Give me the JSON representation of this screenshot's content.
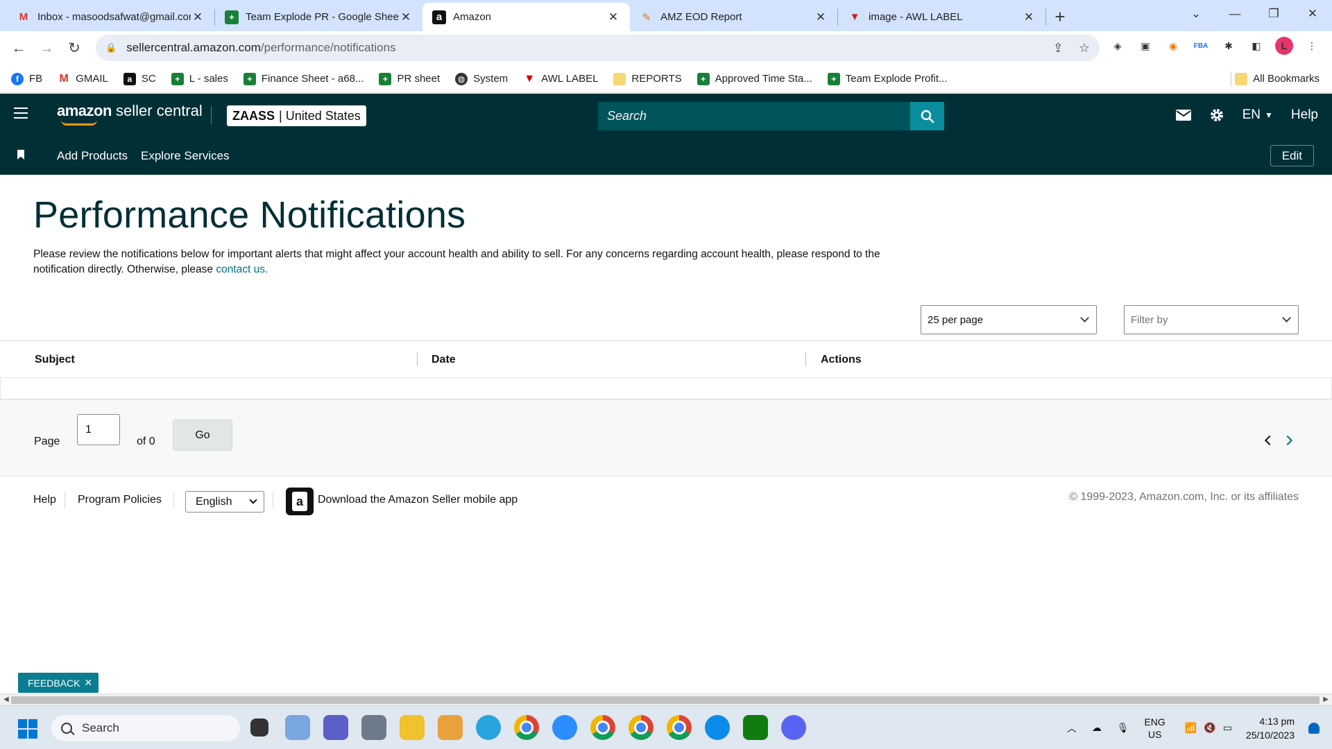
{
  "browser": {
    "tabs": [
      {
        "title": "Inbox - masoodsafwat@gmail.com",
        "icon": "gmail-icon",
        "active": false
      },
      {
        "title": "Team Explode PR - Google Sheets",
        "icon": "sheets-icon",
        "active": false
      },
      {
        "title": "Amazon",
        "icon": "amazon-icon",
        "active": true
      },
      {
        "title": "AMZ EOD Report",
        "icon": "report-icon",
        "active": false
      },
      {
        "title": "image - AWL LABEL",
        "icon": "awl-icon",
        "active": false
      }
    ],
    "url_host": "sellercentral.amazon.com",
    "url_path": "/performance/notifications",
    "profile_initial": "L",
    "bookmarks": [
      {
        "label": "FB",
        "icon": "facebook-icon"
      },
      {
        "label": "GMAIL",
        "icon": "gmail-icon"
      },
      {
        "label": "SC",
        "icon": "amazon-icon"
      },
      {
        "label": "L - sales",
        "icon": "sheets-icon"
      },
      {
        "label": "Finance Sheet - a68...",
        "icon": "sheets-icon"
      },
      {
        "label": "PR sheet",
        "icon": "sheets-icon"
      },
      {
        "label": "System",
        "icon": "globe-icon"
      },
      {
        "label": "AWL LABEL",
        "icon": "awl-icon"
      },
      {
        "label": "REPORTS",
        "icon": "folder-icon"
      },
      {
        "label": "Approved Time Sta...",
        "icon": "sheets-icon"
      },
      {
        "label": "Team Explode Profit...",
        "icon": "sheets-icon"
      }
    ],
    "all_bookmarks": "All Bookmarks"
  },
  "header": {
    "logo_bold": "amazon",
    "logo_rest": " seller central",
    "store_name": "ZAASS",
    "store_region": "| United States",
    "search_placeholder": "Search",
    "language": "EN",
    "help": "Help",
    "nav": [
      "Add Products",
      "Explore Services"
    ],
    "edit": "Edit"
  },
  "main": {
    "title": "Performance Notifications",
    "intro": "Please review the notifications below for important alerts that might affect your account health and ability to sell. For any concerns regarding account health, please respond to the notification directly. Otherwise, please ",
    "contact_link": "contact us.",
    "per_page": "25 per page",
    "filter_by": "Filter by",
    "columns": [
      "Subject",
      "Date",
      "Actions"
    ],
    "rows": []
  },
  "pagination": {
    "page_label": "Page",
    "current_page": "1",
    "of_label": "of 0",
    "go": "Go"
  },
  "footer": {
    "help": "Help",
    "program_policies": "Program Policies",
    "language": "English",
    "app_text": "Download the Amazon Seller mobile app",
    "copyright": "© 1999-2023, Amazon.com, Inc. or its affiliates"
  },
  "feedback": "FEEDBACK",
  "taskbar": {
    "search": "Search",
    "lang_top": "ENG",
    "lang_bottom": "US",
    "time": "4:13 pm",
    "date": "25/10/2023"
  },
  "colors": {
    "header_bg": "#002f36",
    "search_bg": "#00545b",
    "search_btn": "#0a8d9c",
    "title": "#002f36",
    "link": "#007185",
    "feedback_bg": "#0b7d91"
  }
}
